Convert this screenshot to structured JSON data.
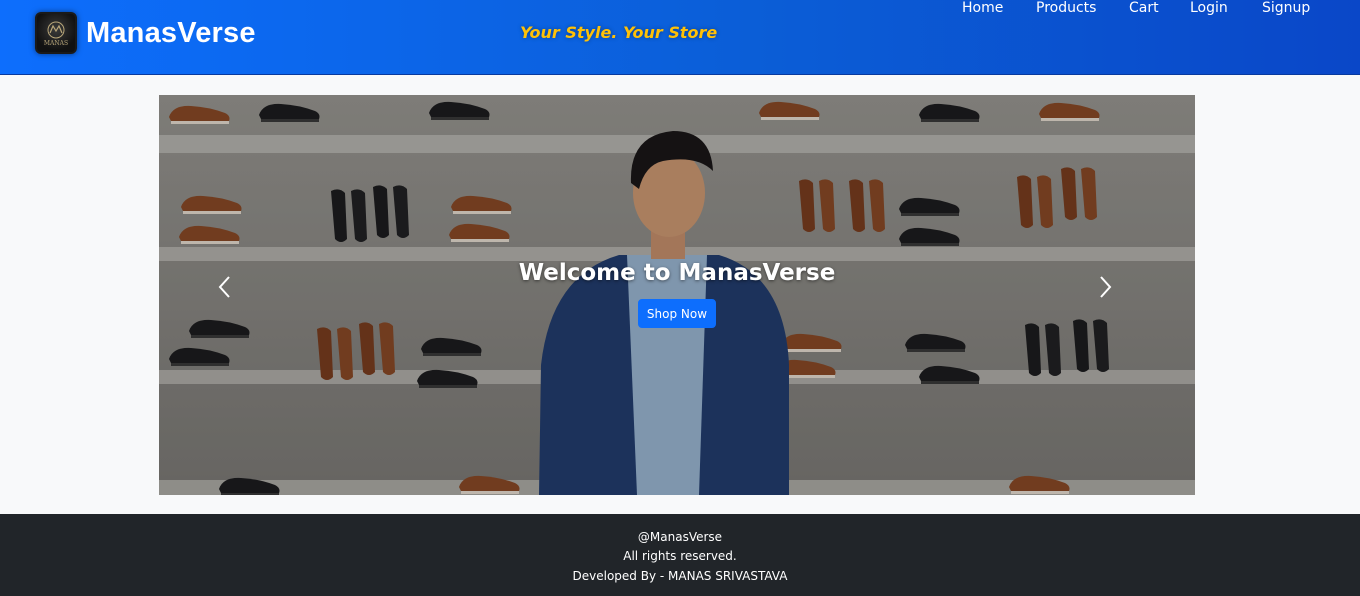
{
  "header": {
    "brand": "ManasVerse",
    "logo_text": "MANAS",
    "tagline": "Your Style. Your Store",
    "nav": [
      "Home",
      "Products",
      "Cart",
      "Login",
      "Signup"
    ]
  },
  "hero": {
    "title": "Welcome to ManasVerse",
    "button": "Shop Now",
    "prev_icon": "chevron-left-icon",
    "next_icon": "chevron-right-icon"
  },
  "footer": {
    "line1": "@ManasVerse",
    "line2": "All rights reserved.",
    "line3": "Developed By - MANAS SRIVASTAVA"
  },
  "colors": {
    "navbar": "#0d6efd",
    "tagline": "#ffc107",
    "button": "#0d6efd",
    "footer": "#212529",
    "page": "#f8f9fa"
  }
}
